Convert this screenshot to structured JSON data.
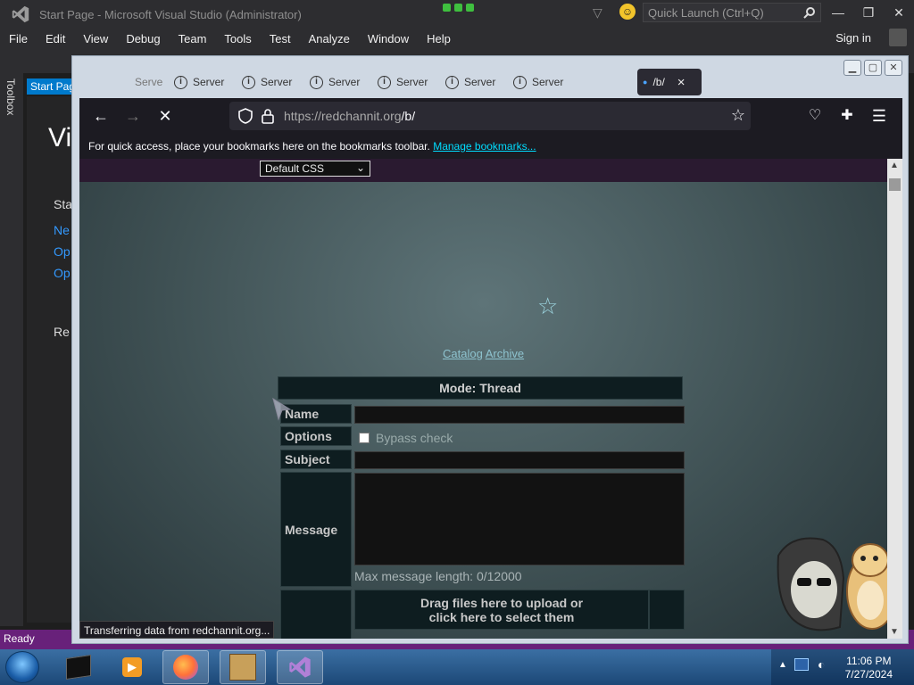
{
  "vs": {
    "title": "Start Page - Microsoft Visual Studio (Administrator)",
    "quick_launch": "Quick Launch (Ctrl+Q)",
    "menu": [
      "File",
      "Edit",
      "View",
      "Debug",
      "Team",
      "Tools",
      "Test",
      "Analyze",
      "Window",
      "Help"
    ],
    "sign_in": "Sign in",
    "toolbox": "Toolbox",
    "doc_tab": "Start Page",
    "start_heading": "Vi",
    "start_section": "Sta",
    "start_links": [
      "Ne",
      "Op",
      "Op"
    ],
    "recent": "Re",
    "status": "Ready",
    "accent": "#68217a"
  },
  "firefox": {
    "tabs": [
      {
        "label": "Serve",
        "icon": "info-icon"
      },
      {
        "label": "Server",
        "icon": "info-icon"
      },
      {
        "label": "Server",
        "icon": "info-icon"
      },
      {
        "label": "Server",
        "icon": "info-icon"
      },
      {
        "label": "Server",
        "icon": "info-icon"
      },
      {
        "label": "Server",
        "icon": "info-icon"
      },
      {
        "label": "Server",
        "icon": "info-icon"
      }
    ],
    "active_tab": {
      "label": "/b/",
      "close": "×"
    },
    "url_host": "https://redchannit.org",
    "url_path": "/b/",
    "bookmarks_text": "For quick access, place your bookmarks here on the bookmarks toolbar.",
    "bookmarks_link": "Manage bookmarks...",
    "status_line": "Transferring data from redchannit.org..."
  },
  "site": {
    "css_select": "Default CSS",
    "catalog": "Catalog",
    "archive": "Archive",
    "mode": "Mode: Thread",
    "labels": {
      "name": "Name",
      "options": "Options",
      "subject": "Subject",
      "message": "Message"
    },
    "bypass": "Bypass check",
    "max_length": "Max message length: 0/12000",
    "drop_line1": "Drag files here to upload or",
    "drop_line2": "click here to select them"
  },
  "taskbar": {
    "time": "11:06 PM",
    "date": "7/27/2024"
  }
}
